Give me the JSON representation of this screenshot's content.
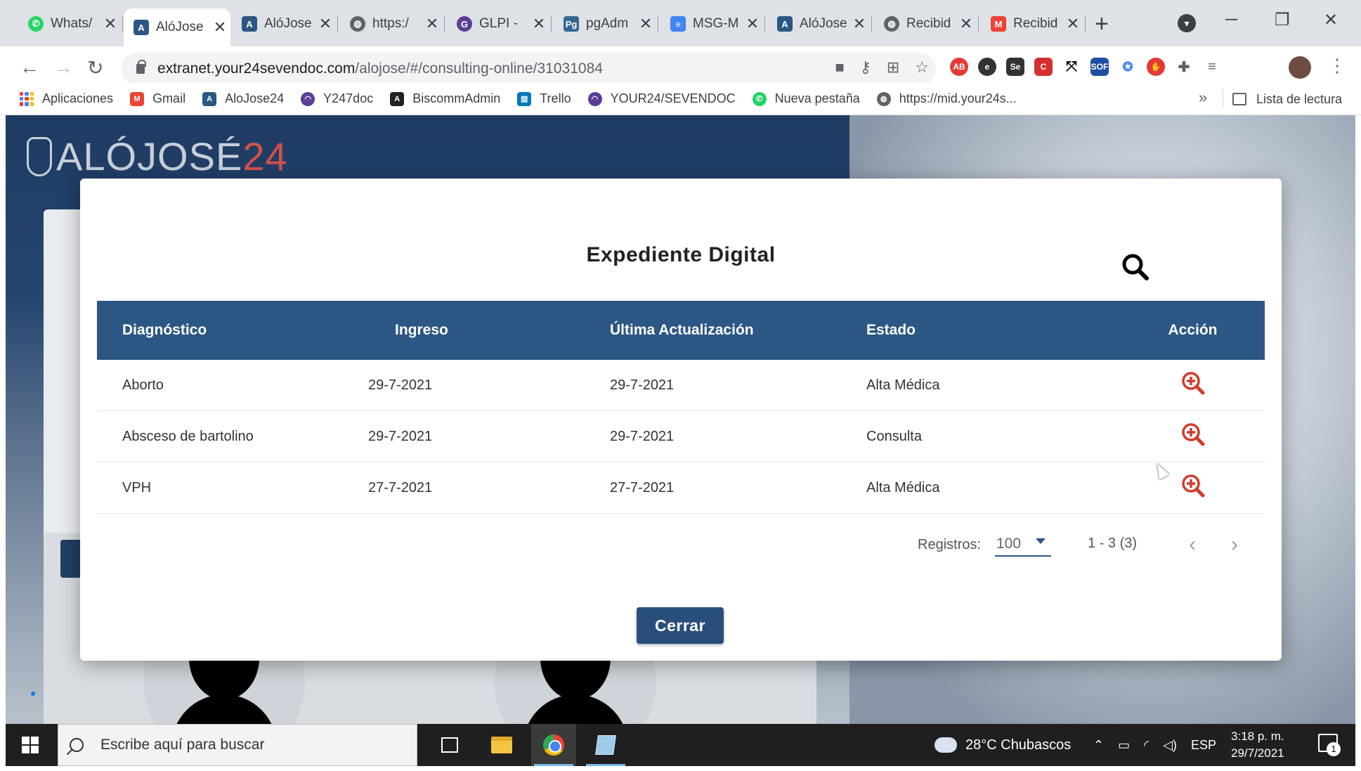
{
  "browser": {
    "tabs": [
      {
        "title": "Whats/",
        "icon": "whatsapp-icon",
        "color": "#25d366"
      },
      {
        "title": "AlóJose",
        "icon": "alojose-icon",
        "color": "#2c5784",
        "active": true
      },
      {
        "title": "AlóJose",
        "icon": "alojose-icon",
        "color": "#2c5784"
      },
      {
        "title": "https:/",
        "icon": "globe-icon",
        "color": "#5f6368"
      },
      {
        "title": "GLPI - ",
        "icon": "glpi-icon",
        "color": "#5b3e96"
      },
      {
        "title": "pgAdm",
        "icon": "pgadmin-icon",
        "color": "#336791"
      },
      {
        "title": "MSG-M",
        "icon": "docs-icon",
        "color": "#4285f4"
      },
      {
        "title": "AlóJose",
        "icon": "alojose-icon",
        "color": "#2c5784"
      },
      {
        "title": "Recibid",
        "icon": "globe-icon",
        "color": "#5f6368"
      },
      {
        "title": "Recibid",
        "icon": "gmail-icon",
        "color": "#ea4335"
      }
    ],
    "url_host": "extranet.your24sevendoc.com",
    "url_path": "/alojose/#/consulting-online/31031084",
    "bookmarks": [
      {
        "label": "Aplicaciones",
        "icon": "apps-grid-icon"
      },
      {
        "label": "Gmail",
        "icon": "gmail-icon",
        "color": "#ea4335"
      },
      {
        "label": "AloJose24",
        "icon": "alojose-icon",
        "color": "#2c5784"
      },
      {
        "label": "Y247doc",
        "icon": "y247-icon",
        "color": "#5b3e96"
      },
      {
        "label": "BiscommAdmin",
        "icon": "angular-icon",
        "color": "#202124"
      },
      {
        "label": "Trello",
        "icon": "trello-icon",
        "color": "#0079bf"
      },
      {
        "label": "YOUR24/SEVENDOC",
        "icon": "y247-icon",
        "color": "#5b3e96"
      },
      {
        "label": "Nueva pestaña",
        "icon": "whatsapp-icon",
        "color": "#25d366"
      },
      {
        "label": "https://mid.your24s...",
        "icon": "globe-icon",
        "color": "#5f6368"
      }
    ],
    "reading_list": "Lista de lectura"
  },
  "page": {
    "logo_text": "ALÓJOSÉ",
    "logo_num": "24"
  },
  "modal": {
    "title": "Expediente Digital",
    "columns": [
      "Diagnóstico",
      "Ingreso",
      "Última Actualización",
      "Estado",
      "Acción"
    ],
    "rows": [
      {
        "diagnostico": "Aborto",
        "ingreso": "29-7-2021",
        "actualizacion": "29-7-2021",
        "estado": "Alta Médica"
      },
      {
        "diagnostico": "Absceso de bartolino",
        "ingreso": "29-7-2021",
        "actualizacion": "29-7-2021",
        "estado": "Consulta"
      },
      {
        "diagnostico": "VPH",
        "ingreso": "27-7-2021",
        "actualizacion": "27-7-2021",
        "estado": "Alta Médica"
      }
    ],
    "registros_label": "Registros:",
    "registros_value": "100",
    "range_text": "1 - 3 (3)",
    "close_label": "Cerrar",
    "accent_color": "#2c5784",
    "action_icon_color": "#d13b2a"
  },
  "taskbar": {
    "search_placeholder": "Escribe aquí para buscar",
    "weather": "28°C  Chubascos",
    "lang": "ESP",
    "time": "3:18 p. m.",
    "date": "29/7/2021",
    "notif_count": "1"
  }
}
